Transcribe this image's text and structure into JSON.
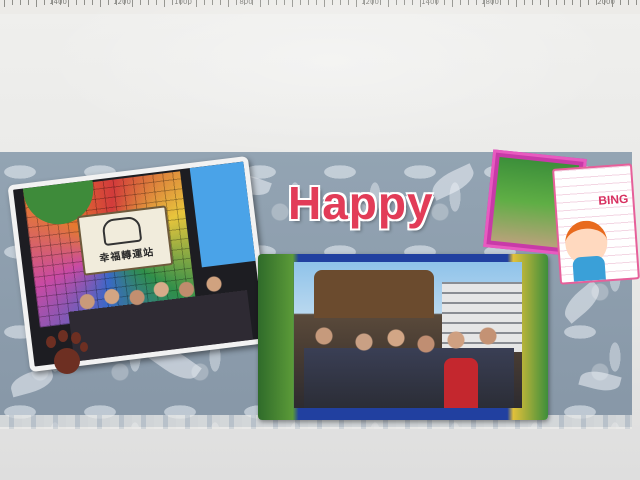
{
  "ruler": {
    "labels": [
      "1400",
      "1200",
      "1000",
      "800",
      "1200",
      "1400",
      "1800",
      "2000"
    ]
  },
  "banner": {
    "title": "Happy",
    "sign_text": "幸福轉運站",
    "card_text": "BING"
  },
  "colors": {
    "title": "#e23c58",
    "banner_background": "#8e9fae",
    "paw": "#6d2f22",
    "card_border": "#e6609a"
  },
  "icons": [
    "paw-print-icon",
    "elephant-icon"
  ]
}
